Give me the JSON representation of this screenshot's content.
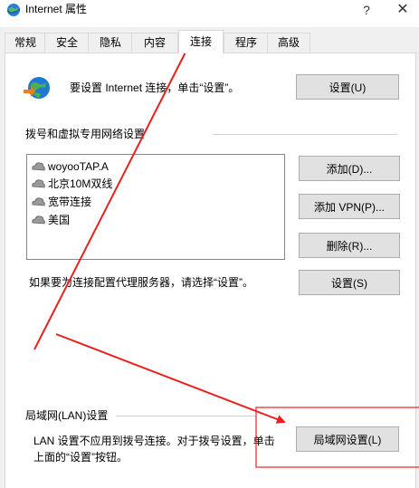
{
  "window": {
    "title": "Internet 属性",
    "help_label": "?",
    "close_label": "✕"
  },
  "tabs": [
    {
      "label": "常规"
    },
    {
      "label": "安全"
    },
    {
      "label": "隐私"
    },
    {
      "label": "内容"
    },
    {
      "label": "连接"
    },
    {
      "label": "程序"
    },
    {
      "label": "高级"
    }
  ],
  "setup": {
    "text": "要设置 Internet 连接，单击“设置”。",
    "button": "设置(U)"
  },
  "dialup": {
    "section_title": "拨号和虚拟专用网络设置",
    "connections": [
      {
        "name": "woyooTAP.A"
      },
      {
        "name": "北京10M双线"
      },
      {
        "name": "宽带连接"
      },
      {
        "name": "美国"
      }
    ],
    "add_button": "添加(D)...",
    "add_vpn_button": "添加 VPN(P)...",
    "remove_button": "删除(R)...",
    "proxy_text": "如果要为连接配置代理服务器，请选择“设置”。",
    "settings_button": "设置(S)"
  },
  "lan": {
    "section_title": "局域网(LAN)设置",
    "text_line1": "LAN 设置不应用到拨号连接。对于拨号设置，单击",
    "text_line2": "上面的“设置”按钮。",
    "button": "局域网设置(L)"
  },
  "colors": {
    "annotation": "#e8211d",
    "active_tab": "#ffffff",
    "panel": "#ffffff",
    "window_bg": "#f0f0f0"
  }
}
